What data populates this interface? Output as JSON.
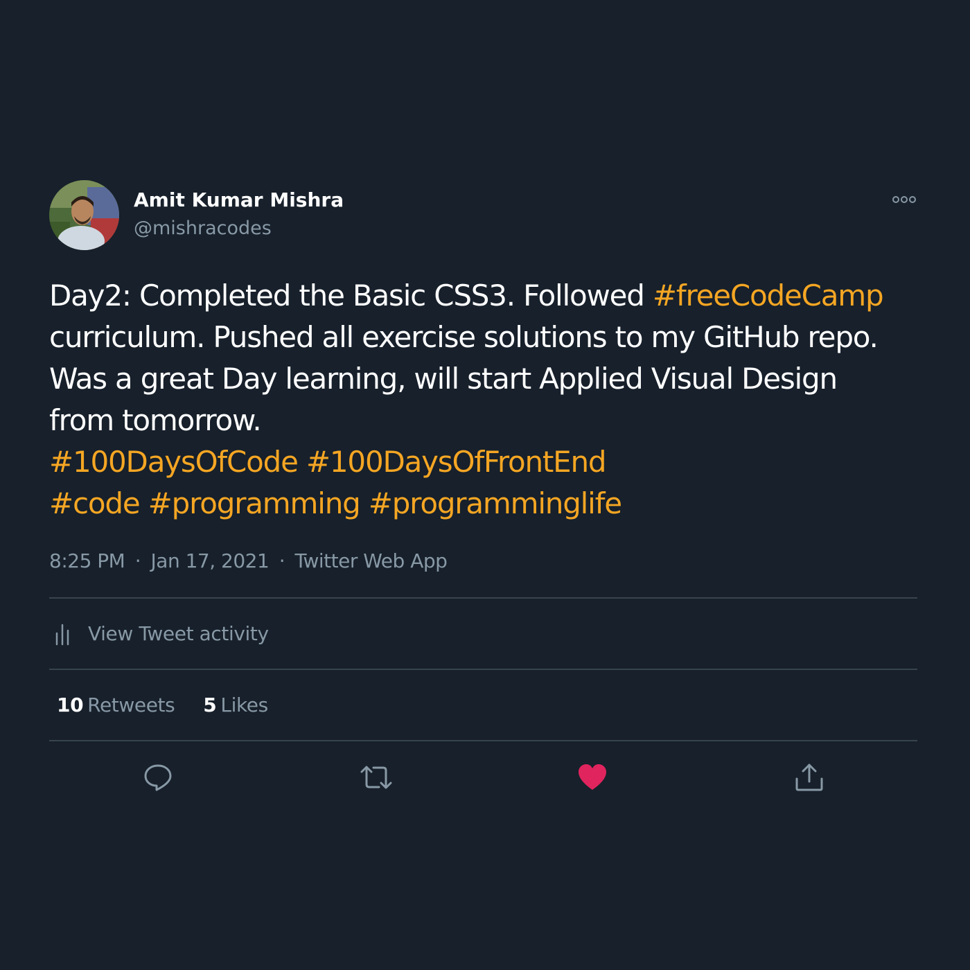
{
  "colors": {
    "background": "#17202b",
    "hashtag": "#f5a623",
    "secondary_text": "#8899a6",
    "divider": "#38444d",
    "like_active": "#e0245e"
  },
  "author": {
    "name": "Amit Kumar Mishra",
    "handle": "@mishracodes"
  },
  "tweet": {
    "lines": [
      [
        {
          "text": "Day2: Completed the Basic CSS3. Followed ",
          "hashtag": false
        },
        {
          "text": "#freeCodeCamp",
          "hashtag": true
        }
      ],
      [
        {
          "text": "curriculum. Pushed all exercise solutions to my GitHub repo.",
          "hashtag": false
        }
      ],
      [
        {
          "text": "Was a great Day learning, will start Applied Visual Design",
          "hashtag": false
        }
      ],
      [
        {
          "text": "from tomorrow.",
          "hashtag": false
        }
      ],
      [
        {
          "text": "#100DaysOfCode",
          "hashtag": true
        },
        {
          "text": " ",
          "hashtag": false
        },
        {
          "text": "#100DaysOfFrontEnd",
          "hashtag": true
        }
      ],
      [
        {
          "text": "#code",
          "hashtag": true
        },
        {
          "text": " ",
          "hashtag": false
        },
        {
          "text": "#programming",
          "hashtag": true
        },
        {
          "text": " ",
          "hashtag": false
        },
        {
          "text": "#programminglife",
          "hashtag": true
        }
      ]
    ]
  },
  "meta": {
    "time": "8:25 PM",
    "separator": "·",
    "date": "Jan 17, 2021",
    "source": "Twitter Web App"
  },
  "activity": {
    "label": "View Tweet activity",
    "icon": "bar-chart-icon"
  },
  "stats": {
    "retweets_count": "10",
    "retweets_label": "Retweets",
    "likes_count": "5",
    "likes_label": "Likes"
  },
  "actions": {
    "reply_icon": "reply-icon",
    "retweet_icon": "retweet-icon",
    "like_icon": "heart-icon",
    "like_active": true,
    "share_icon": "share-icon"
  },
  "more_icon": "more-options-icon"
}
